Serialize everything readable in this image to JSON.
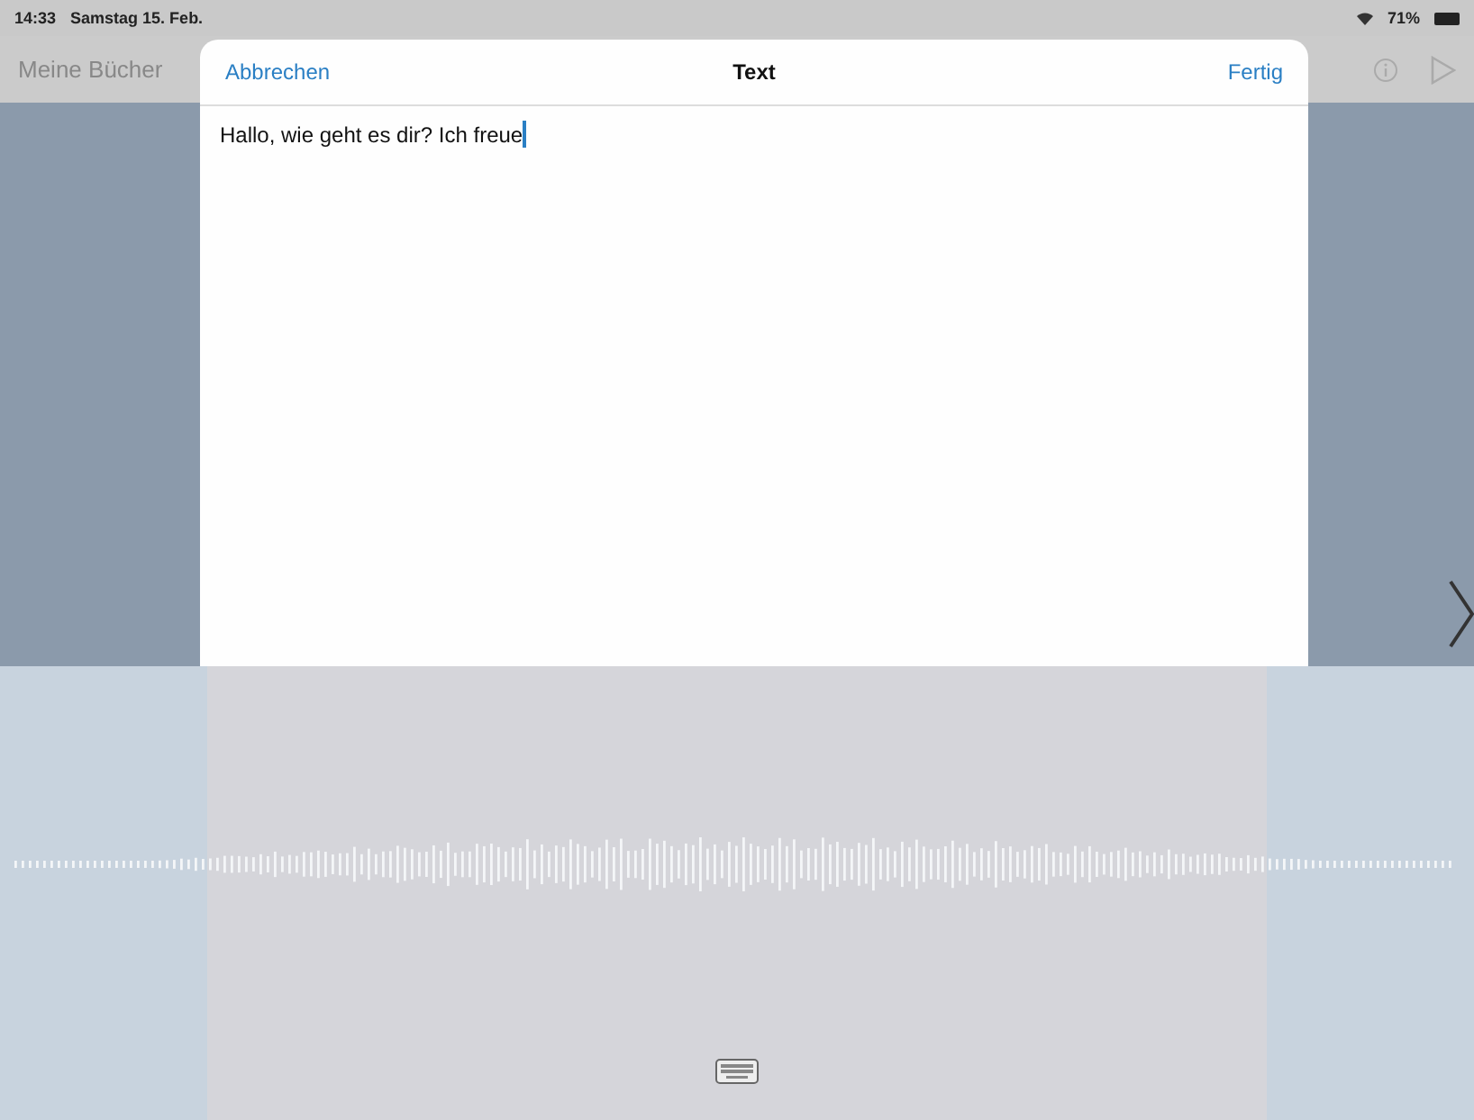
{
  "status_bar": {
    "time": "14:33",
    "date": "Samstag 15. Feb.",
    "battery": "71%"
  },
  "nav_bar": {
    "back": "Meine Bücher"
  },
  "sheet": {
    "cancel": "Abbrechen",
    "title": "Text",
    "done": "Fertig",
    "value": "Hallo, wie geht es dir? Ich freue"
  }
}
